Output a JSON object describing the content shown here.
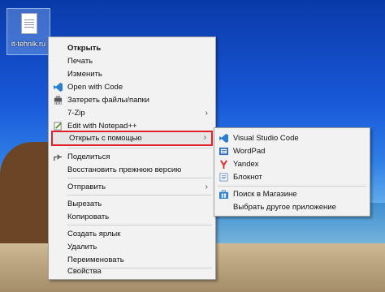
{
  "desktop_icon": {
    "label": "it-tehnik.ru"
  },
  "context_menu": {
    "items": [
      {
        "label": "Открыть"
      },
      {
        "label": "Печать"
      },
      {
        "label": "Изменить"
      },
      {
        "label": "Open with Code"
      },
      {
        "label": "Затереть файлы/папки"
      },
      {
        "label": "7-Zip"
      },
      {
        "label": "Edit with Notepad++"
      },
      {
        "label": "Открыть с помощью"
      },
      {
        "label": "Поделиться"
      },
      {
        "label": "Восстановить прежнюю версию"
      },
      {
        "label": "Отправить"
      },
      {
        "label": "Вырезать"
      },
      {
        "label": "Копировать"
      },
      {
        "label": "Создать ярлык"
      },
      {
        "label": "Удалить"
      },
      {
        "label": "Переименовать"
      },
      {
        "label": "Свойства"
      }
    ]
  },
  "submenu": {
    "items": [
      {
        "label": "Visual Studio Code"
      },
      {
        "label": "WordPad"
      },
      {
        "label": "Yandex"
      },
      {
        "label": "Блокнот"
      },
      {
        "label": "Поиск в Магазине"
      },
      {
        "label": "Выбрать другое приложение"
      }
    ]
  },
  "colors": {
    "highlight_border": "#e0202a",
    "vscode": "#2a7fd4",
    "yandex": "#e52620"
  }
}
